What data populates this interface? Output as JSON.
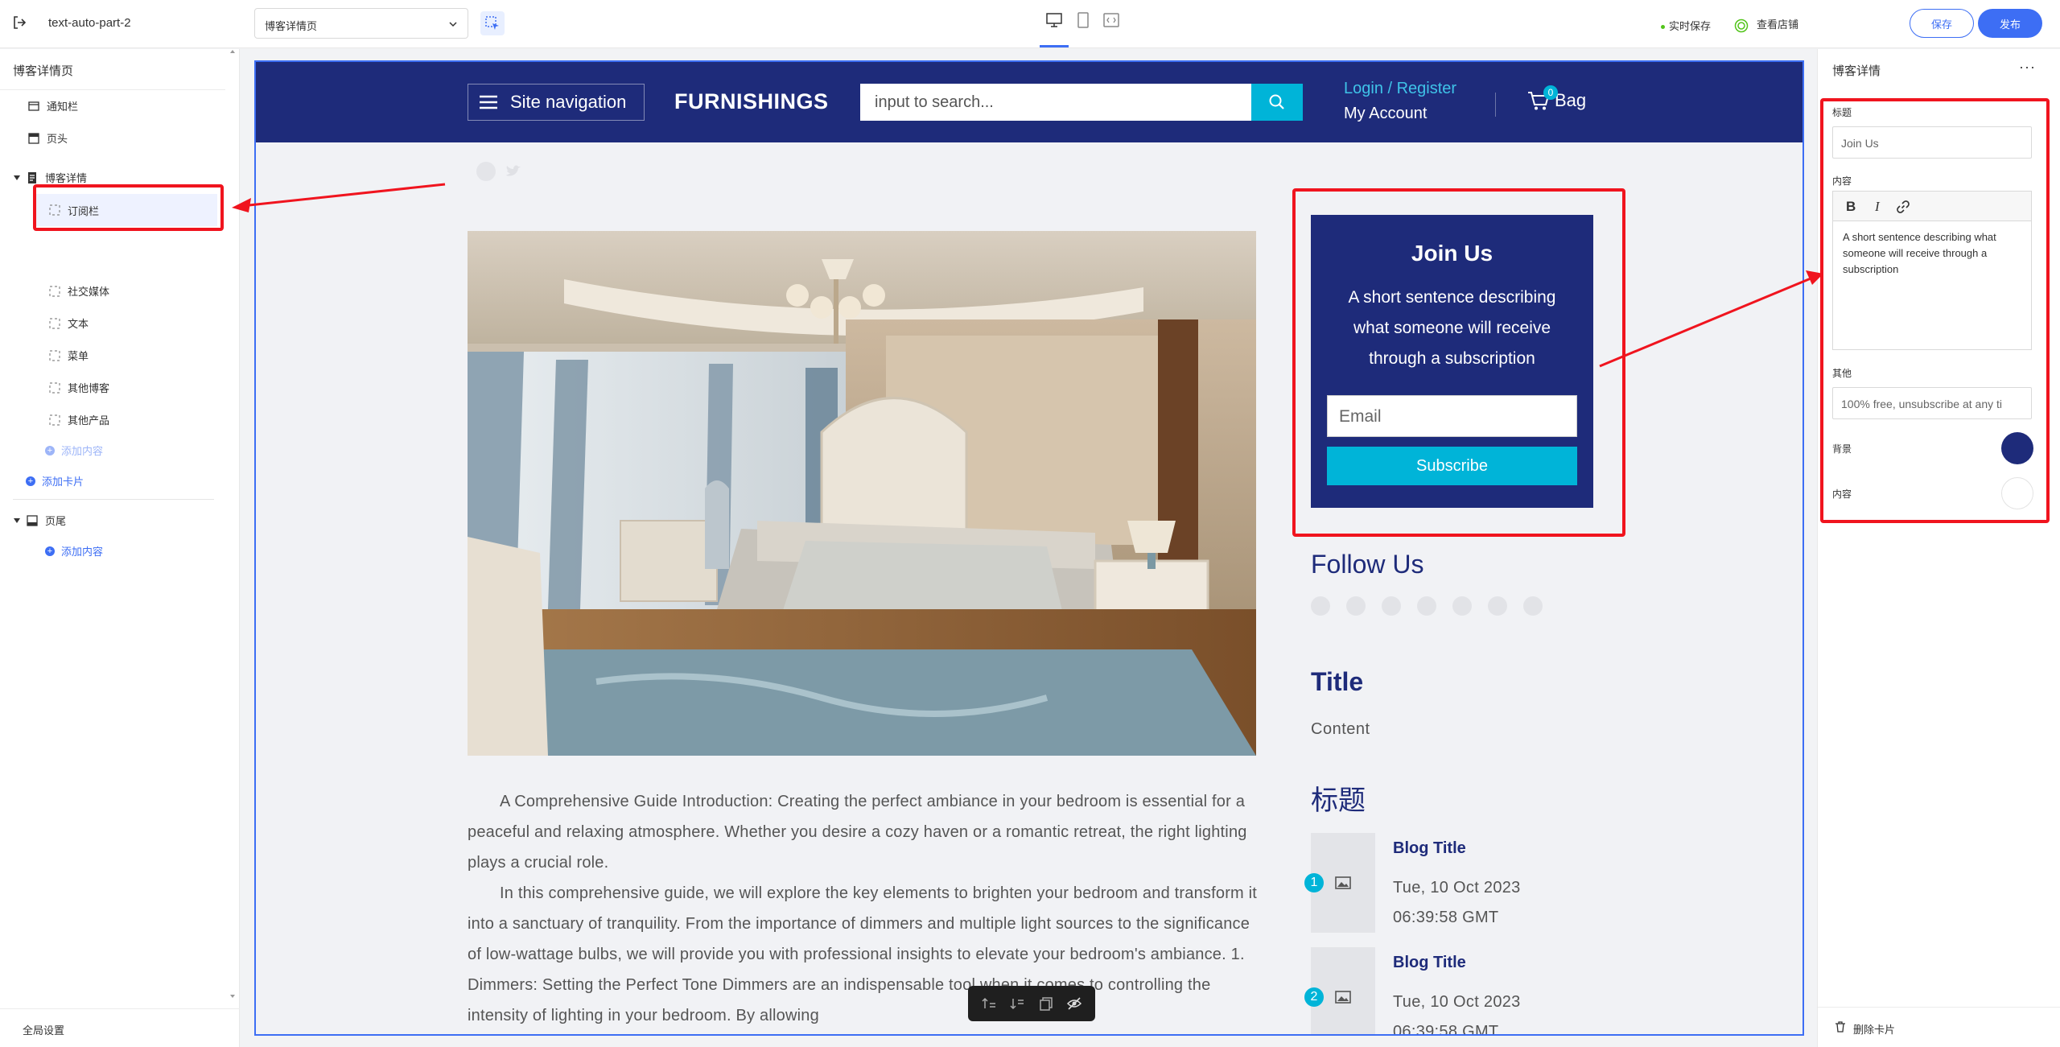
{
  "topbar": {
    "project_name": "text-auto-part-2",
    "page_select": "博客详情页",
    "autosave": "实时保存",
    "view_store": "查看店铺",
    "save": "保存",
    "publish": "发布"
  },
  "leftbar": {
    "title": "博客详情页",
    "items": [
      {
        "label": "通知栏",
        "icon": "notice-icon"
      },
      {
        "label": "页头",
        "icon": "header-icon"
      },
      {
        "label": "博客详情",
        "icon": "blog-detail-icon"
      },
      {
        "label": "订阅栏",
        "icon": "block-icon"
      },
      {
        "label": "社交媒体",
        "icon": "block-icon"
      },
      {
        "label": "文本",
        "icon": "block-icon"
      },
      {
        "label": "菜单",
        "icon": "block-icon"
      },
      {
        "label": "其他博客",
        "icon": "block-icon"
      },
      {
        "label": "其他产品",
        "icon": "block-icon"
      }
    ],
    "add_content": "添加内容",
    "add_card": "添加卡片",
    "footer_label": "页尾",
    "footer_add_content": "添加内容",
    "global_settings": "全局设置"
  },
  "site": {
    "nav_label": "Site navigation",
    "logo": "FURNISHINGS",
    "search_placeholder": "input to search...",
    "login": "Login / Register",
    "account": "My Account",
    "bag": "Bag",
    "bag_count": "0",
    "brand_color": "#1e2b7a",
    "accent_color": "#00b4d8"
  },
  "article": {
    "paragraphs": [
      "A Comprehensive Guide Introduction: Creating the perfect ambiance in your bedroom is essential for a peaceful and relaxing atmosphere. Whether you desire a cozy haven or a romantic retreat, the right lighting plays a crucial role.",
      "In this comprehensive guide, we will explore the key elements to brighten your bedroom and transform it into a sanctuary of tranquility. From the importance of dimmers and multiple light sources to the significance of low-wattage bulbs, we will provide you with professional insights to elevate your bedroom's ambiance. 1. Dimmers: Setting the Perfect Tone Dimmers are an indispensable tool when it comes to controlling the intensity of lighting in your bedroom. By allowing"
    ]
  },
  "join": {
    "title": "Join Us",
    "text": "A short sentence describing what someone will receive through a subscription",
    "email_placeholder": "Email",
    "subscribe": "Subscribe"
  },
  "sidebar_widgets": {
    "follow_title": "Follow Us",
    "text_title": "Title",
    "text_content": "Content",
    "cn_title": "标题",
    "blogs": [
      {
        "num": "1",
        "title": "Blog Title",
        "date": "Tue, 10 Oct 2023 06:39:58 GMT"
      },
      {
        "num": "2",
        "title": "Blog Title",
        "date": "Tue, 10 Oct 2023 06:39:58 GMT"
      }
    ]
  },
  "rightpanel": {
    "title": "博客详情",
    "more": "···",
    "title_label": "标题",
    "title_value": "Join Us",
    "content_label": "内容",
    "content_value": "A short sentence describing what someone will receive through a subscription",
    "other_label": "其他",
    "other_value": "100% free, unsubscribe at any ti",
    "bg_label": "背景",
    "bg_color": "#1e2b7a",
    "fg_label": "内容",
    "fg_color": "#ffffff",
    "delete_card": "删除卡片"
  }
}
